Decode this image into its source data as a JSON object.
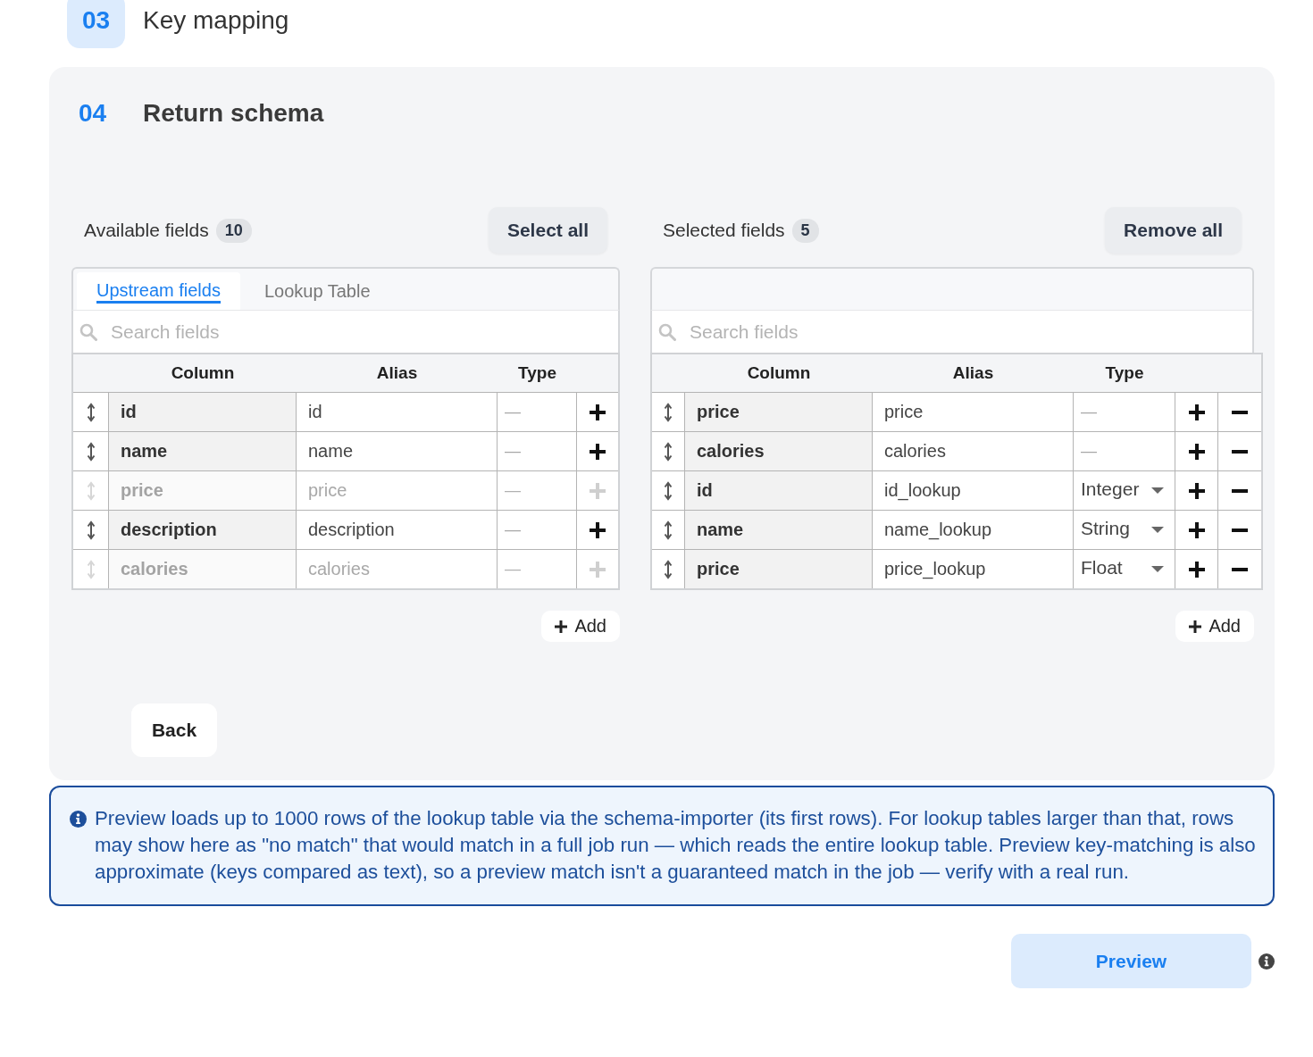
{
  "previous_step": {
    "number": "03",
    "title": "Key mapping"
  },
  "step": {
    "number": "04",
    "title": "Return schema"
  },
  "panels": [
    {
      "kind": "source",
      "label": "Available fields",
      "count": "10",
      "action": "Select all",
      "tabs": [
        {
          "label": "Upstream fields",
          "selected": true
        },
        {
          "label": "Lookup Table",
          "selected": false
        }
      ],
      "search": {
        "placeholder": "Search fields"
      },
      "columns": [
        "Column",
        "Alias",
        "Type"
      ],
      "rows": [
        {
          "column": "id",
          "alias": "id",
          "type": "—",
          "kind": "dash",
          "disabled": false
        },
        {
          "column": "name",
          "alias": "name",
          "type": "—",
          "kind": "dash",
          "disabled": false
        },
        {
          "column": "price",
          "alias": "price",
          "type": "—",
          "kind": "dash",
          "disabled": true
        },
        {
          "column": "description",
          "alias": "description",
          "type": "—",
          "kind": "dash",
          "disabled": false
        },
        {
          "column": "calories",
          "alias": "calories",
          "type": "—",
          "kind": "dash",
          "disabled": true
        }
      ],
      "add_button": "Add"
    },
    {
      "kind": "target",
      "label": "Selected fields",
      "count": "5",
      "action": "Remove all",
      "search": {
        "placeholder": "Search fields"
      },
      "columns": [
        "Column",
        "Alias",
        "Type"
      ],
      "rows": [
        {
          "column": "price",
          "alias": "price",
          "type": "—",
          "kind": "dash"
        },
        {
          "column": "calories",
          "alias": "calories",
          "type": "—",
          "kind": "dash"
        },
        {
          "column": "id",
          "alias": "id_lookup",
          "type": "Integer",
          "kind": "select"
        },
        {
          "column": "name",
          "alias": "name_lookup",
          "type": "String",
          "kind": "select"
        },
        {
          "column": "price",
          "alias": "price_lookup",
          "type": "Float",
          "kind": "select"
        }
      ],
      "add_button": "Add"
    }
  ],
  "back_button": "Back",
  "notice": "Preview loads up to 1000 rows of the lookup table via the schema-importer (its first rows). For lookup tables larger than that, rows may show here as \"no match\" that would match in a full job run — which reads the entire lookup table. Preview key-matching is also approximate (keys compared as text), so a preview match isn't a guaranteed match in the job — verify with a real run.",
  "preview_button": "Preview"
}
